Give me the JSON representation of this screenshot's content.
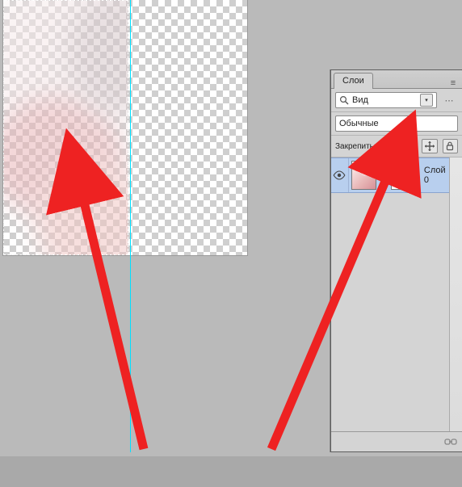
{
  "panel": {
    "tab_label": "Слои",
    "filter_label": "Вид",
    "blend_mode": "Обычные",
    "lock_label": "Закрепить:"
  },
  "layer0": {
    "name": "Слой 0"
  },
  "icons": {
    "panel_menu": "≡",
    "filter_extras": "⋯"
  }
}
